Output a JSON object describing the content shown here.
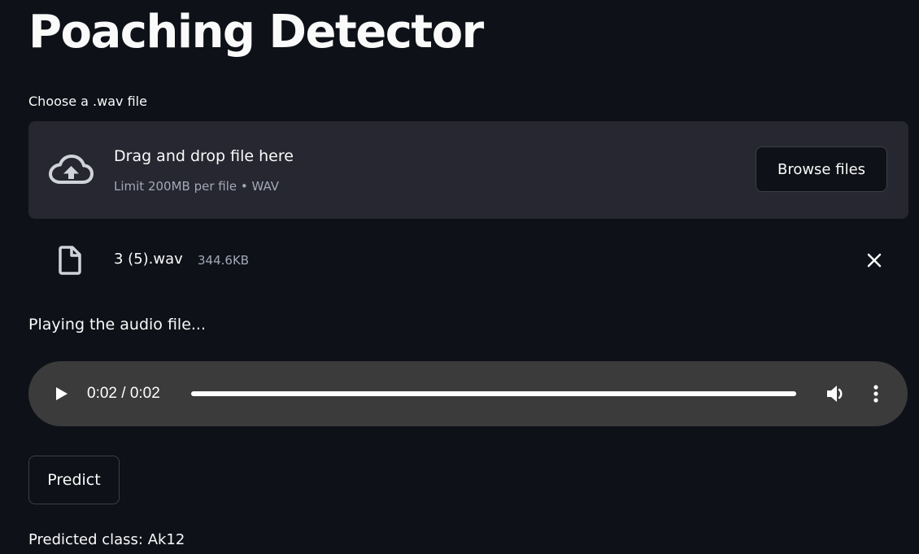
{
  "app": {
    "title": "Poaching Detector"
  },
  "uploader": {
    "label": "Choose a .wav file",
    "dropzone_title": "Drag and drop file here",
    "dropzone_subtitle": "Limit 200MB per file • WAV",
    "browse_label": "Browse files",
    "icon": "cloud-upload-icon"
  },
  "uploaded_file": {
    "name": "3 (5).wav",
    "size": "344.6KB",
    "icon": "file-icon",
    "remove_icon": "close-icon"
  },
  "audio": {
    "caption": "Playing the audio file...",
    "time": "0:02 / 0:02",
    "progress": 1.0,
    "icons": [
      "play-icon",
      "volume-icon",
      "more-vertical-icon"
    ]
  },
  "predict": {
    "button_label": "Predict",
    "result": "Predicted class: Ak12"
  },
  "colors": {
    "background": "#0e1117",
    "panel": "#262730",
    "player": "#3b3b3b",
    "text": "#fafafa",
    "muted": "#a3a8b8"
  }
}
